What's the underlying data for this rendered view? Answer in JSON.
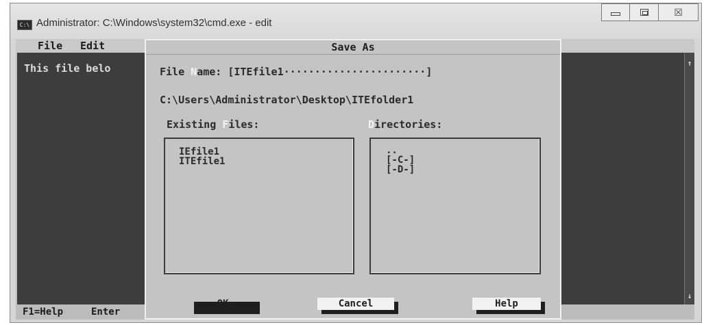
{
  "window": {
    "title": "Administrator: C:\\Windows\\system32\\cmd.exe - edit",
    "icon_text": "C:\\",
    "icon": "cmd-icon",
    "controls": [
      "minimize-icon",
      "maximize-icon",
      "close-icon"
    ],
    "close_glyph": "☒"
  },
  "editor": {
    "menu": [
      {
        "label": "File"
      },
      {
        "label": "Edit"
      }
    ],
    "line1": "This file belo",
    "status_help": "F1=Help",
    "status_enter": "Enter",
    "scroll_up": "↑",
    "scroll_down": "↓"
  },
  "dialog": {
    "title": "Save As",
    "file_name_label_pre": "File ",
    "file_name_label_hot": "N",
    "file_name_label_post": "ame: ",
    "file_name_value": "[ITEfile1·······················]",
    "path": "C:\\Users\\Administrator\\Desktop\\ITEfolder1",
    "existing_files_pre": "Existing ",
    "existing_files_hot": "F",
    "existing_files_post": "iles:",
    "directories_hot": "D",
    "directories_post": "irectories:",
    "files": [
      "IEfile1",
      "ITEfile1"
    ],
    "directories": [
      "..",
      "[-C-]",
      "[-D-]"
    ],
    "buttons": {
      "ok_left_arrow": "►",
      "ok_label": "OK",
      "ok_right_arrow": "◄",
      "cancel_label": "Cancel",
      "help_label": "Help"
    }
  },
  "colors": {
    "console_background": "#3d3d3d",
    "dialog_background": "#c4c4c4",
    "button_face": "#f2f2f2",
    "hotkey": "#f4f4f4"
  }
}
